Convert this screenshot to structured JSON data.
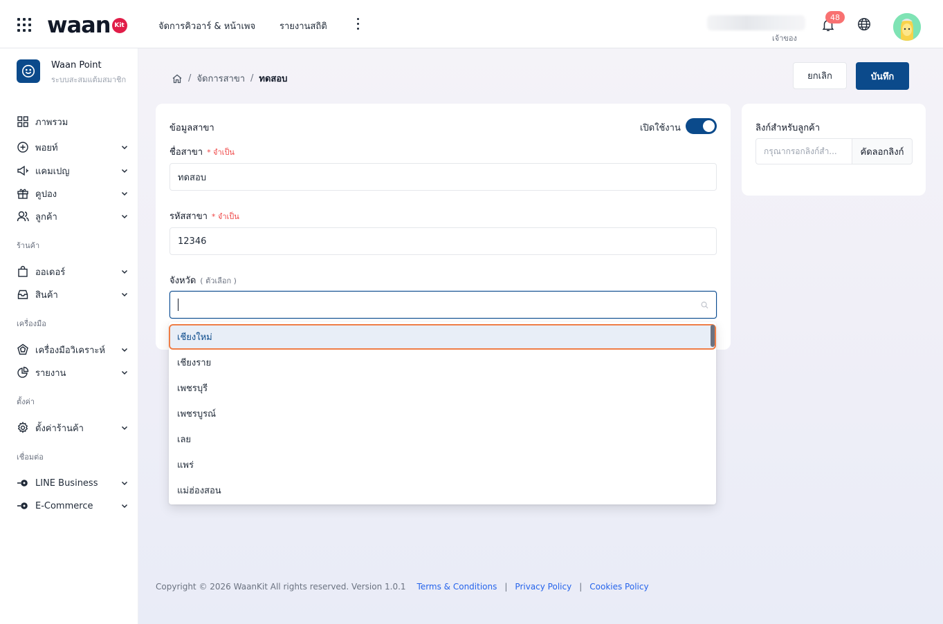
{
  "header": {
    "logo_text": "waan",
    "logo_badge": "Kit",
    "nav": [
      "จัดการคิวอาร์ & หน้าเพจ",
      "รายงานสถิติ"
    ],
    "user_role": "เจ้าของ",
    "notification_count": "48"
  },
  "sidebar": {
    "brand_title": "Waan Point",
    "brand_subtitle": "ระบบสะสมแต้มสมาชิก",
    "items": [
      {
        "label": "ภาพรวม",
        "icon": "grid-icon"
      },
      {
        "label": "พอยท์",
        "icon": "plus-circle-icon"
      },
      {
        "label": "แคมเปญ",
        "icon": "megaphone-icon"
      },
      {
        "label": "คูปอง",
        "icon": "gift-icon"
      },
      {
        "label": "ลูกค้า",
        "icon": "users-icon"
      },
      {
        "label": "ออเดอร์",
        "icon": "bag-icon"
      },
      {
        "label": "สินค้า",
        "icon": "inbox-icon"
      },
      {
        "label": "เครื่องมือวิเคราะห์",
        "icon": "analytics-icon"
      },
      {
        "label": "รายงาน",
        "icon": "pie-chart-icon"
      },
      {
        "label": "ตั้งค่าร้านค้า",
        "icon": "gear-icon"
      },
      {
        "label": "LINE Business",
        "icon": "plug-icon"
      },
      {
        "label": "E-Commerce",
        "icon": "plug-icon"
      }
    ],
    "sections": [
      "ร้านค้า",
      "เครื่องมือ",
      "ตั้งค่า",
      "เชื่อมต่อ"
    ]
  },
  "breadcrumb": {
    "parent": "จัดการสาขา",
    "current": "ทดสอบ"
  },
  "actions": {
    "cancel": "ยกเลิก",
    "save": "บันทึก"
  },
  "form": {
    "title": "ข้อมูลสาขา",
    "toggle_label": "เปิดใช้งาน",
    "required_text": "* จำเป็น",
    "optional_text": "( ตัวเลือก )",
    "name_label": "ชื่อสาขา",
    "name_value": "ทดสอบ",
    "code_label": "รหัสสาขา",
    "code_value": "12346",
    "province_label": "จังหวัด",
    "province_value": ""
  },
  "province_options": [
    "เชียงใหม่",
    "เชียงราย",
    "เพชรบุรี",
    "เพชรบูรณ์",
    "เลย",
    "แพร่",
    "แม่ฮ่องสอน"
  ],
  "link_card": {
    "title": "ลิงก์สำหรับลูกค้า",
    "placeholder": "กรุณากรอกลิงก์สำ...",
    "copy_button": "คัดลอกลิงก์"
  },
  "footer": {
    "copyright": "Copyright © 2026 WaanKit All rights reserved. Version 1.0.1",
    "links": [
      "Terms & Conditions",
      "Privacy Policy",
      "Cookies Policy"
    ]
  },
  "colors": {
    "primary": "#0b4a8b",
    "danger": "#ef4444",
    "highlight_outline": "#ef7d45",
    "link": "#2563eb"
  }
}
